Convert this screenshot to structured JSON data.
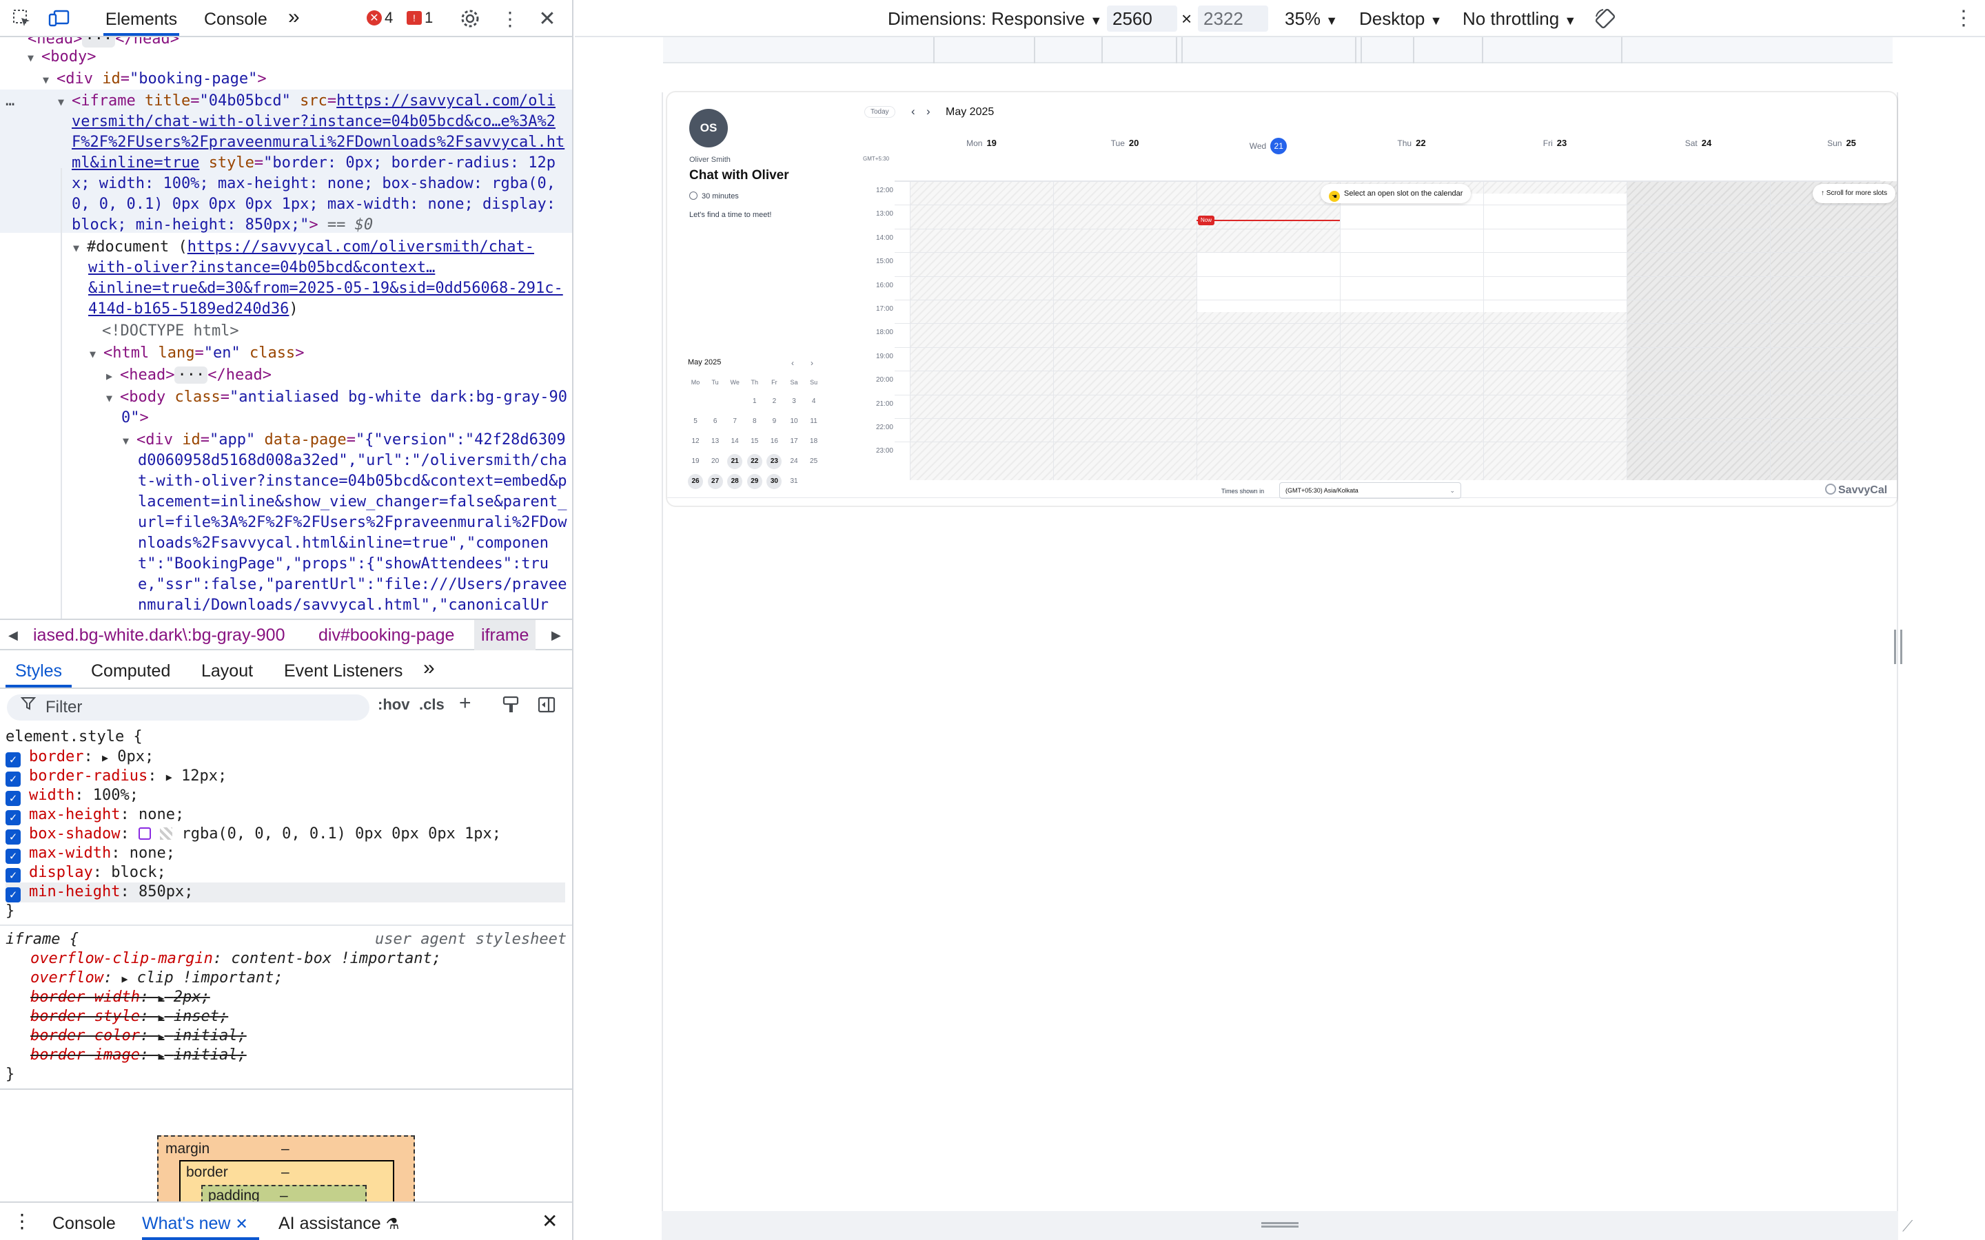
{
  "devtools": {
    "tabs": {
      "elements": "Elements",
      "console": "Console",
      "more": "»"
    },
    "errors": "4",
    "warnings": "1",
    "dom_lines": [
      {
        "t": "closed-head",
        "text": "<head>…</head>"
      },
      {
        "t": "body",
        "text": "<body>"
      },
      {
        "t": "div",
        "open": "<div ",
        "attr": "id",
        "val": "\"booking-page\"",
        "close": ">"
      },
      {
        "t": "iframe"
      },
      {
        "t": "document"
      },
      {
        "t": "doctype",
        "text": "<!DOCTYPE html>"
      },
      {
        "t": "html"
      },
      {
        "t": "head"
      },
      {
        "t": "bodyclass"
      },
      {
        "t": "app"
      }
    ],
    "iframe_title_val": "\"04b05bcd\"",
    "iframe_src": "https://savvycal.com/oliversmith/chat-with-oliver?instance=04b05bcd&co…e%3A%2F%2F%2FUsers%2Fpraveenmurali%2FDownloads%2Fsavvycal.html&inline=true",
    "iframe_src_l1": "https://savvycal.com/oli",
    "iframe_src_l2": "versmith/chat-with-oliver?instance=04b05bcd&co…e%3A%2",
    "iframe_src_l3": "F%2F%2FUsers%2Fpraveenmurali%2FDownloads%2Fsavvycal.ht",
    "iframe_src_l4": "ml&inline=true",
    "iframe_style_l1": "\"border: 0px; border-radius: 12p",
    "iframe_style_l2": "x; width: 100%; max-height: none; box-shadow: rgba(0,",
    "iframe_style_l3": "0, 0, 0.1) 0px 0px 0px 1px; max-width: none; display:",
    "iframe_style_l4": "block; min-height: 850px;\"",
    "dollar": "== $0",
    "doc_l1": "https://savvycal.com/oliversmith/chat-",
    "doc_l2": "with-oliver?instance=04b05bcd&context…",
    "doc_l3": "&inline=true&d=30&from=2025-05-19&sid=0dd56068-291c-",
    "doc_l4": "414d-b165-5189ed240d36",
    "html_lang": "\"en\"",
    "body_class_l1": "\"antialiased bg-white dark:bg-gray-90",
    "body_class_l2": "0\"",
    "app_l1": "\"{\"version\":\"42f28d6309",
    "app_l2": "d0060958d5168d008a32ed\",\"url\":\"/oliversmith/cha",
    "app_l3": "t-with-oliver?instance=04b05bcd&context=embed&p",
    "app_l4": "lacement=inline&show_view_changer=false&parent_",
    "app_l5": "url=file%3A%2F%2F%2FUsers%2Fpraveenmurali%2FDow",
    "app_l6": "nloads%2Fsavvycal.html&inline=true\",\"componen",
    "app_l7": "t\":\"BookingPage\",\"props\":{\"showAttendees\":tru",
    "app_l8": "e,\"ssr\":false,\"parentUrl\":\"file:///Users/pravee",
    "app_l9": "nmurali/Downloads/savvycal.html\",\"canonicalUr",
    "crumbs": [
      "iased.bg-white.dark\\:bg-gray-900",
      "div#booking-page",
      "iframe"
    ],
    "style_tabs": {
      "styles": "Styles",
      "computed": "Computed",
      "layout": "Layout",
      "listeners": "Event Listeners",
      "more": "»"
    },
    "filter_placeholder": "Filter",
    "hov": ":hov",
    "cls": ".cls",
    "element_style": "element.style {",
    "rules": [
      {
        "p": "border",
        "v": "0px",
        "arrow": true
      },
      {
        "p": "border-radius",
        "v": "12px",
        "arrow": true
      },
      {
        "p": "width",
        "v": "100%"
      },
      {
        "p": "max-height",
        "v": "none"
      },
      {
        "p": "box-shadow",
        "v": "rgba(0, 0, 0, 0.1) 0px 0px 0px 1px",
        "swatch": true
      },
      {
        "p": "max-width",
        "v": "none"
      },
      {
        "p": "display",
        "v": "block"
      },
      {
        "p": "min-height",
        "v": "850px"
      }
    ],
    "close_brace": "}",
    "ua_selector": "iframe {",
    "ua_label": "user agent stylesheet",
    "ua_rules": [
      {
        "p": "overflow-clip-margin",
        "v": "content-box !important",
        "strike": false
      },
      {
        "p": "overflow",
        "v": "clip !important",
        "strike": false,
        "arrow": true
      },
      {
        "p": "border-width",
        "v": "2px",
        "strike": true,
        "arrow": true
      },
      {
        "p": "border-style",
        "v": "inset",
        "strike": true,
        "arrow": true
      },
      {
        "p": "border-color",
        "v": "initial",
        "strike": true,
        "arrow": true
      },
      {
        "p": "border-image",
        "v": "initial",
        "strike": true,
        "arrow": true
      }
    ],
    "boxmodel": {
      "margin": "margin",
      "border": "border",
      "padding": "padding",
      "dash": "–"
    },
    "drawer": {
      "console": "Console",
      "whats_new": "What's new",
      "ai": "AI assistance"
    }
  },
  "device": {
    "dimensions": "Dimensions: Responsive",
    "width": "2560",
    "x": "×",
    "height": "2322",
    "zoom": "35%",
    "mode": "Desktop",
    "throttle": "No throttling"
  },
  "booking": {
    "initials": "OS",
    "host": "Oliver Smith",
    "title": "Chat with Oliver",
    "duration": "30 minutes",
    "message": "Let's find a time to meet!",
    "today": "Today",
    "month": "May 2025",
    "tz_label": "GMT+5:30",
    "days": [
      {
        "d": "Mon",
        "n": "19"
      },
      {
        "d": "Tue",
        "n": "20"
      },
      {
        "d": "Wed",
        "n": "21",
        "today": true
      },
      {
        "d": "Thu",
        "n": "22"
      },
      {
        "d": "Fri",
        "n": "23"
      },
      {
        "d": "Sat",
        "n": "24"
      },
      {
        "d": "Sun",
        "n": "25"
      }
    ],
    "hours": [
      "12:00",
      "13:00",
      "14:00",
      "15:00",
      "16:00",
      "17:00",
      "18:00",
      "19:00",
      "20:00",
      "21:00",
      "22:00",
      "23:00"
    ],
    "now_label": "Now",
    "select_hint": "Select an open slot on the calendar",
    "scroll_hint": "↑ Scroll for more slots",
    "mini_month": "May 2025",
    "weekdays": [
      "Mo",
      "Tu",
      "We",
      "Th",
      "Fr",
      "Sa",
      "Su"
    ],
    "weeks": [
      [
        "",
        "",
        "",
        "1",
        "2",
        "3",
        "4"
      ],
      [
        "5",
        "6",
        "7",
        "8",
        "9",
        "10",
        "11"
      ],
      [
        "12",
        "13",
        "14",
        "15",
        "16",
        "17",
        "18"
      ],
      [
        "19",
        "20",
        "21",
        "22",
        "23",
        "24",
        "25"
      ],
      [
        "26",
        "27",
        "28",
        "29",
        "30",
        "31",
        ""
      ]
    ],
    "available": [
      "21",
      "22",
      "23",
      "26",
      "27",
      "28",
      "29",
      "30"
    ],
    "times_shown": "Times shown in",
    "timezone": "(GMT+05:30) Asia/Kolkata",
    "brand": "SavvyCal"
  }
}
